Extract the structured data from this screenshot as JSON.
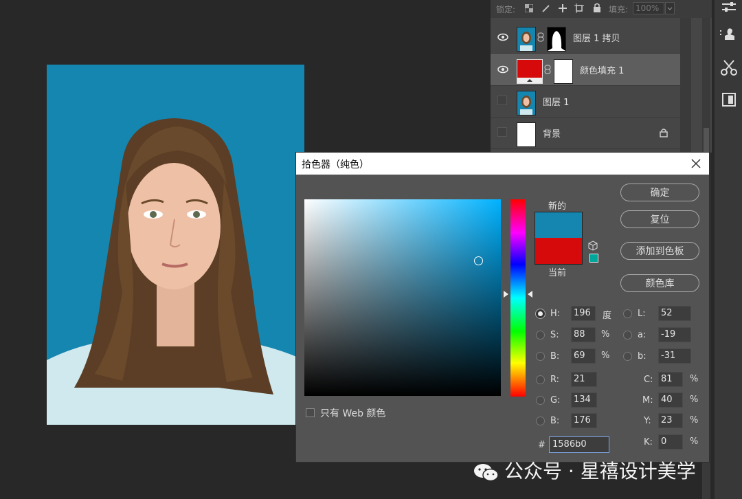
{
  "layers_panel": {
    "lock_label": "锁定:",
    "fill_label": "填充:",
    "fill_value": "100%",
    "layers": [
      {
        "name": "图层 1 拷贝",
        "visible": true,
        "selected": false
      },
      {
        "name": "颜色填充 1",
        "visible": true,
        "selected": true
      },
      {
        "name": "图层 1",
        "visible": false,
        "selected": false
      },
      {
        "name": "背景",
        "visible": false,
        "selected": false,
        "locked": true
      }
    ]
  },
  "dialog": {
    "title": "拾色器（纯色）",
    "new_label": "新的",
    "current_label": "当前",
    "buttons": {
      "ok": "确定",
      "reset": "复位",
      "add_swatch": "添加到色板",
      "color_library": "颜色库"
    },
    "web_only_label": "只有 Web 颜色",
    "hsb": {
      "h_label": "H:",
      "h_value": "196",
      "h_unit": "度",
      "s_label": "S:",
      "s_value": "88",
      "s_unit": "%",
      "b_label": "B:",
      "b_value": "69",
      "b_unit": "%"
    },
    "lab": {
      "l_label": "L:",
      "l_value": "52",
      "a_label": "a:",
      "a_value": "-19",
      "b_label": "b:",
      "b_value": "-31"
    },
    "rgb": {
      "r_label": "R:",
      "r_value": "21",
      "g_label": "G:",
      "g_value": "134",
      "b_label": "B:",
      "b_value": "176"
    },
    "cmyk": {
      "c_label": "C:",
      "c_value": "81",
      "m_label": "M:",
      "m_value": "40",
      "y_label": "Y:",
      "y_value": "23",
      "k_label": "K:",
      "k_value": "0",
      "unit": "%"
    },
    "hex_label": "#",
    "hex_value": "1586b0",
    "colors": {
      "new": "#1586b0",
      "current": "#d60a0a",
      "field_hue": "#00b2ff"
    }
  },
  "watermark": "公众号 · 星禧设计美学"
}
